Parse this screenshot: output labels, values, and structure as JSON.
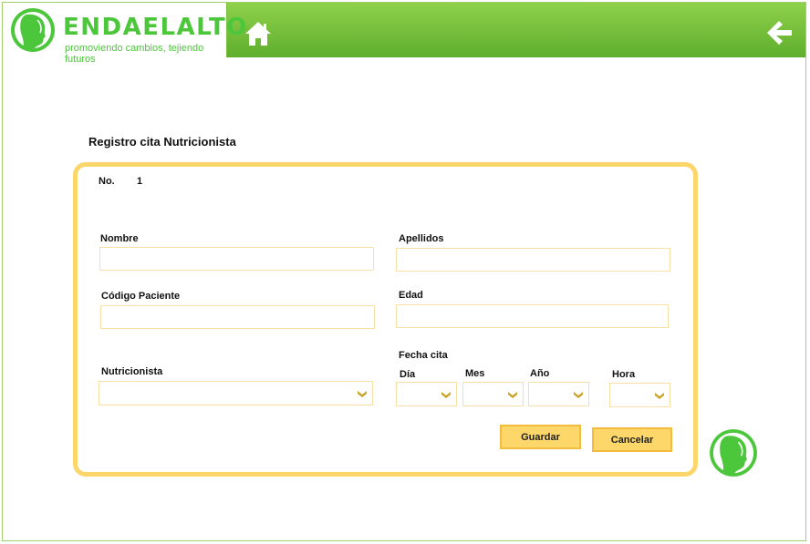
{
  "header": {
    "brand": "ENDAELALTO",
    "tagline": "promoviendo cambios, tejiendo futuros"
  },
  "form": {
    "title": "Registro cita Nutricionista",
    "number_label": "No.",
    "number_value": "1",
    "fields": {
      "nombre": {
        "label": "Nombre",
        "value": ""
      },
      "apellidos": {
        "label": "Apellidos",
        "value": ""
      },
      "codigo": {
        "label": "Código Paciente",
        "value": ""
      },
      "edad": {
        "label": "Edad",
        "value": ""
      },
      "nutricionista": {
        "label": "Nutricionista",
        "selected": ""
      },
      "fecha_cita": "Fecha cita",
      "dia": {
        "label": "Día",
        "selected": ""
      },
      "mes": {
        "label": "Mes",
        "selected": ""
      },
      "anio": {
        "label": "Año",
        "selected": ""
      },
      "hora": {
        "label": "Hora",
        "selected": ""
      }
    },
    "buttons": {
      "save": "Guardar",
      "cancel": "Cancelar"
    }
  },
  "icons": {
    "home": "home-icon",
    "back": "arrow-left-icon",
    "logo": "face-profile-logo-icon",
    "dropdown": "chevron-down-icon"
  },
  "colors": {
    "brand_green": "#4cc63a",
    "header_green": "#6cbd35",
    "card_border": "#fcd66a",
    "button_fill": "#fdd769",
    "chevron": "#c9a326"
  }
}
